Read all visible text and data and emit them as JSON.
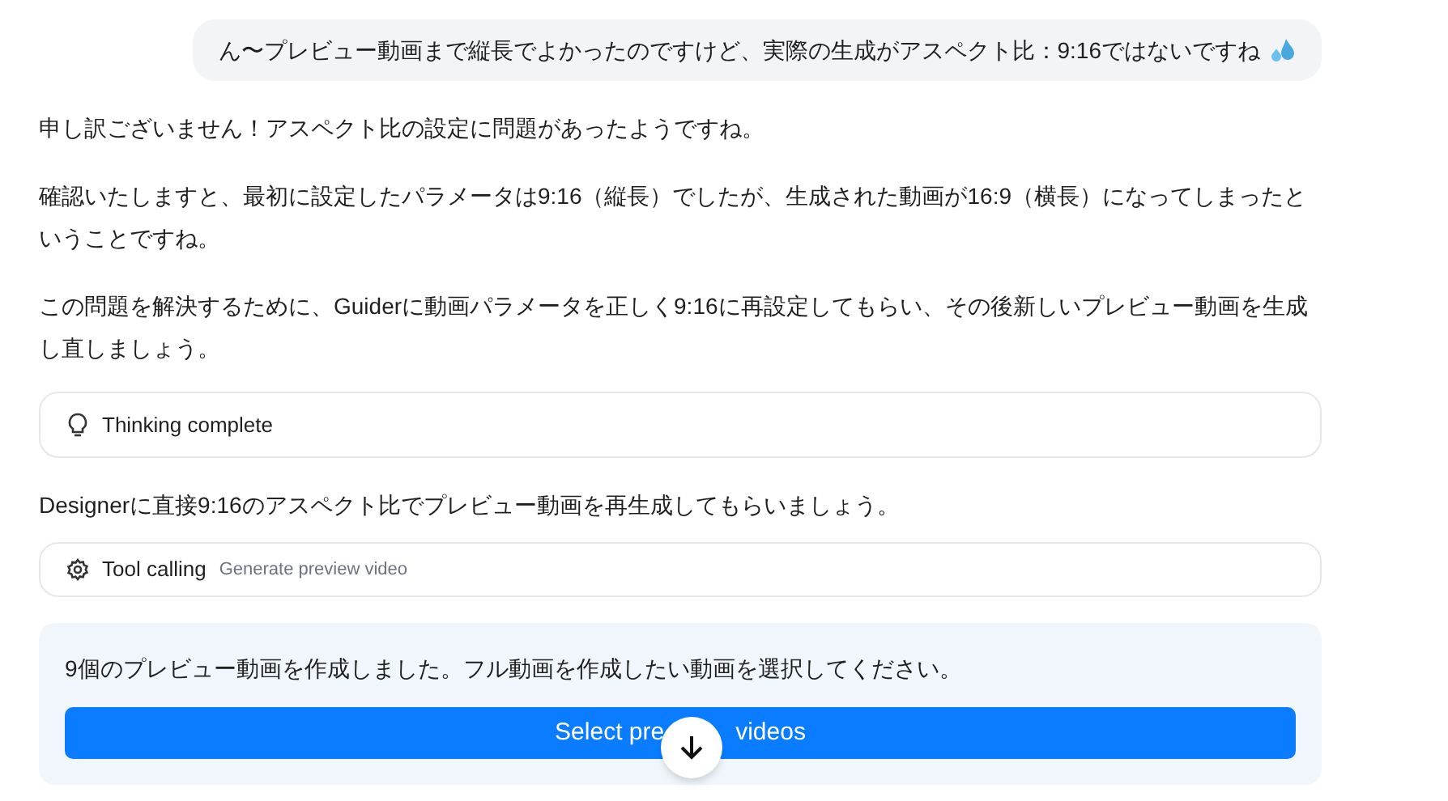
{
  "user_message": {
    "text": "ん〜プレビュー動画まで縦長でよかったのですけど、実際の生成がアスペクト比：9:16ではないですね"
  },
  "assistant_paragraphs": [
    "申し訳ございません！アスペクト比の設定に問題があったようですね。",
    "確認いたしますと、最初に設定したパラメータは9:16（縦長）でしたが、生成された動画が16:9（横長）になってしまったということですね。",
    "この問題を解決するために、Guiderに動画パラメータを正しく9:16に再設定してもらい、その後新しいプレビュー動画を生成し直しましょう。"
  ],
  "thinking_card": {
    "label": "Thinking complete"
  },
  "designer_paragraph": "Designerに直接9:16のアスペクト比でプレビュー動画を再生成してもらいましょう。",
  "tool_card": {
    "label": "Tool calling",
    "detail": "Generate preview video"
  },
  "result_panel": {
    "message": "9個のプレビュー動画を作成しました。フル動画を作成したい動画を選択してください。",
    "button_text_start": "Select pre",
    "button_text_end": "videos"
  }
}
